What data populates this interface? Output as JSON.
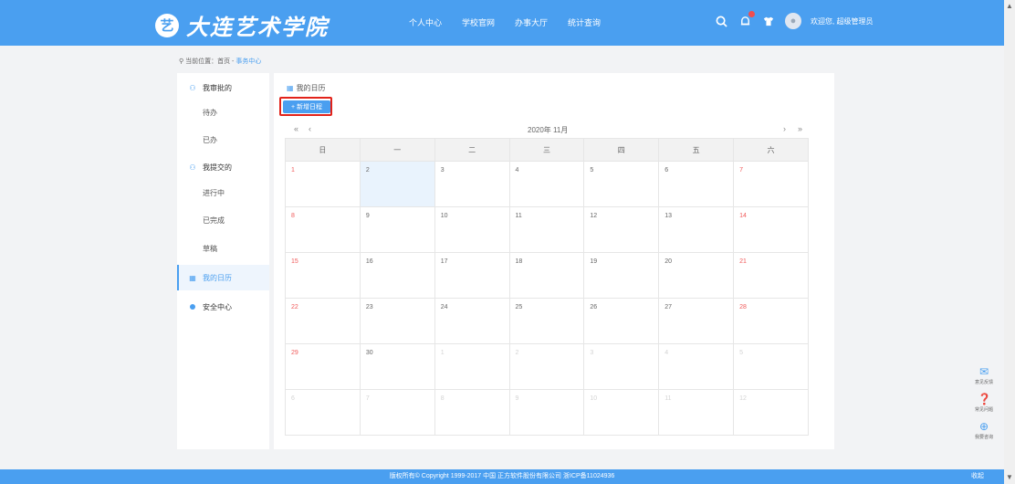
{
  "app": {
    "logo_text": "大连艺术学院",
    "logo_mark": "艺"
  },
  "header": {
    "nav": [
      "个人中心",
      "学校官网",
      "办事大厅",
      "统计查询"
    ],
    "welcome": "欢迎您, 超级管理员"
  },
  "breadcrumb": {
    "prefix": "当前位置：首页 - ",
    "current": "事务中心"
  },
  "sidebar": {
    "group1": "我审批的",
    "group1_items": [
      "待办",
      "已办"
    ],
    "group2": "我提交的",
    "group2_items": [
      "进行中",
      "已完成",
      "草稿"
    ],
    "calendar": "我的日历",
    "security": "安全中心"
  },
  "calendar": {
    "title": "我的日历",
    "add_button": "+ 新增日程",
    "month_label": "2020年 11月",
    "nav_prev_year": "«",
    "nav_prev": "‹",
    "nav_next": "›",
    "nav_next_year": "»",
    "weekdays": [
      "日",
      "一",
      "二",
      "三",
      "四",
      "五",
      "六"
    ],
    "weeks": [
      [
        "1",
        "2",
        "3",
        "4",
        "5",
        "6",
        "7"
      ],
      [
        "8",
        "9",
        "10",
        "11",
        "12",
        "13",
        "14"
      ],
      [
        "15",
        "16",
        "17",
        "18",
        "19",
        "20",
        "21"
      ],
      [
        "22",
        "23",
        "24",
        "25",
        "26",
        "27",
        "28"
      ],
      [
        "29",
        "30",
        "1",
        "2",
        "3",
        "4",
        "5"
      ],
      [
        "6",
        "7",
        "8",
        "9",
        "10",
        "11",
        "12"
      ]
    ]
  },
  "tools": {
    "t1": "意见反馈",
    "t2": "常见问题",
    "t3": "我要咨询"
  },
  "footer": {
    "text": "版权所有© Copyright 1999-2017 中国 正方软件股份有限公司 浙ICP备11024936",
    "right": "收起"
  },
  "colors": {
    "primary": "#4a9ff0",
    "weekend": "#f05a5a",
    "highlight": "#e2231a"
  }
}
